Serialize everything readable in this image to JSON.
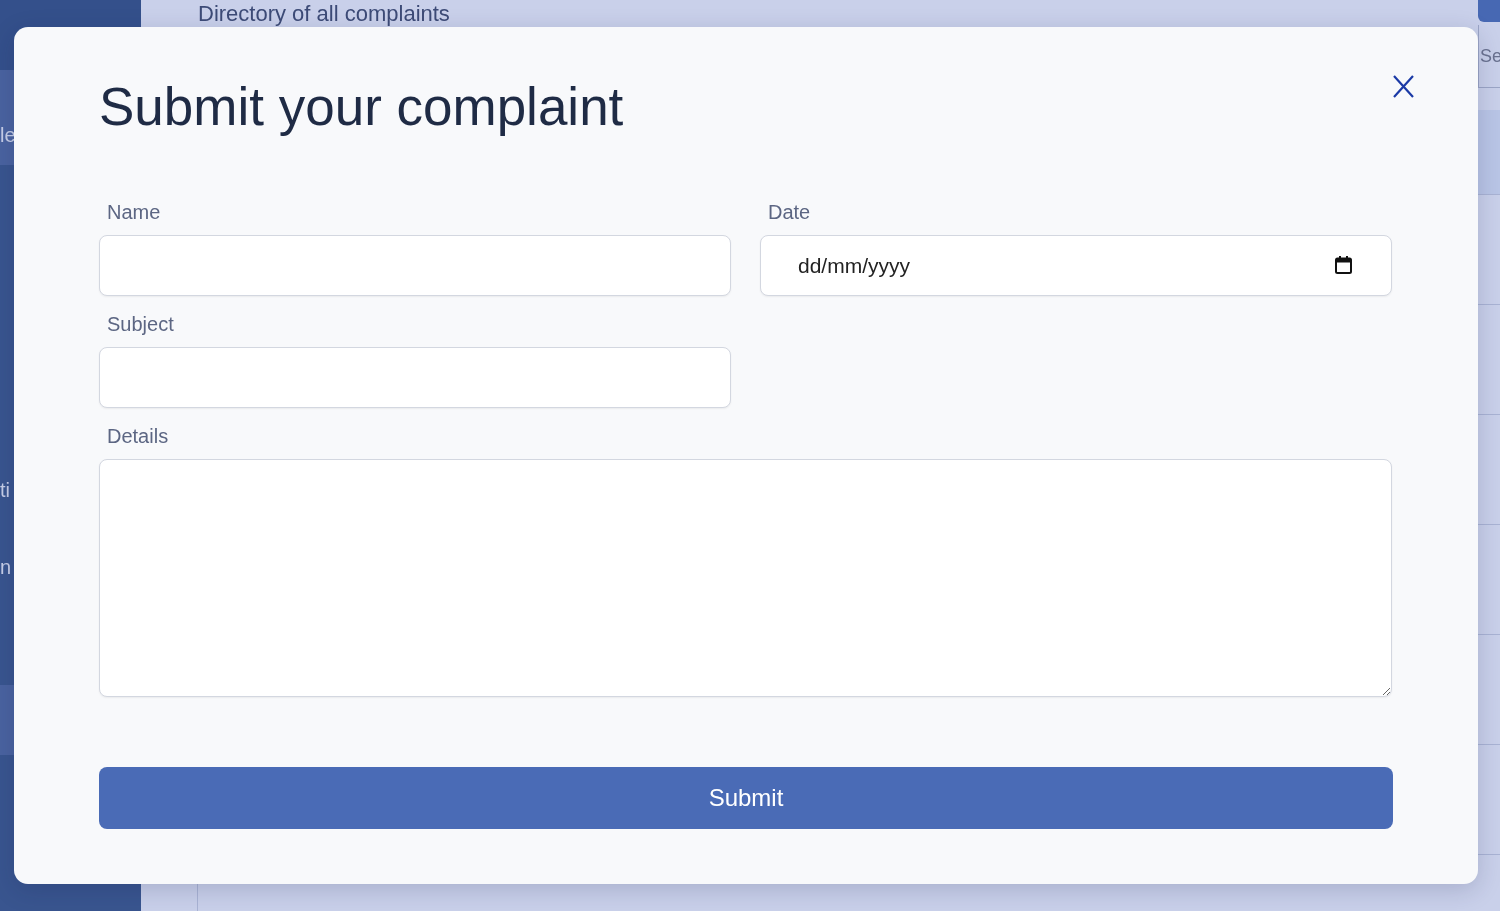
{
  "sidebar": {
    "items": [
      {
        "label": "le"
      },
      {
        "label": "ti"
      },
      {
        "label": "n"
      }
    ]
  },
  "page": {
    "heading": "Directory of all complaints",
    "search": {
      "placeholder": "Se"
    }
  },
  "dialog": {
    "title": "Submit your complaint",
    "fields": [
      {
        "kind": "text",
        "label": "Name"
      },
      {
        "kind": "date",
        "label": "Date",
        "placeholder": "dd/mm/yyyy"
      },
      {
        "kind": "text",
        "label": "Subject"
      },
      {
        "kind": "textarea",
        "label": "Details"
      }
    ],
    "submit_button": "Submit"
  }
}
